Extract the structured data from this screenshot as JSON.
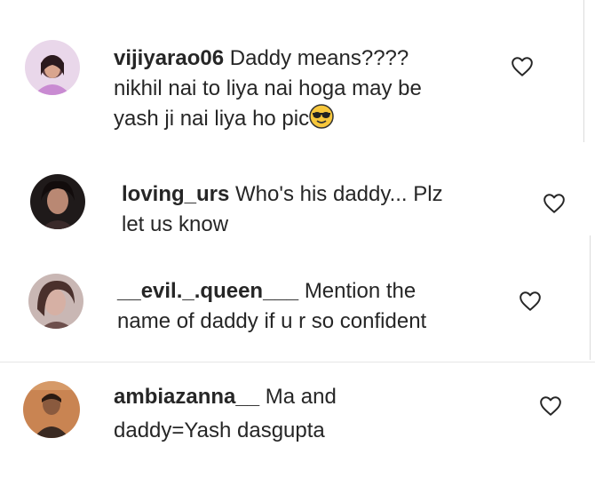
{
  "comments": [
    {
      "username": "vijiyarao06",
      "lines": [
        "Daddy means????",
        "nikhil nai to liya nai hoga may be",
        "yash ji nai liya ho pic"
      ],
      "emoji": "sunglasses-emoji",
      "avatar_color": "#c98bd2"
    },
    {
      "username": "loving_urs",
      "lines": [
        "Who's his daddy... Plz",
        "let us know"
      ],
      "avatar_color": "#5a3a33"
    },
    {
      "username": "__evil._.queen___",
      "lines": [
        "Mention the",
        "name of daddy if u r so confident"
      ],
      "avatar_color": "#7a5a55"
    },
    {
      "username": "ambiazanna__",
      "lines": [
        "Ma and",
        "daddy=Yash dasgupta"
      ],
      "avatar_color": "#b06d3d"
    }
  ],
  "icons": {
    "like": "heart-outline-icon"
  },
  "colors": {
    "text": "#262626",
    "background": "#ffffff",
    "divider": "#dbdbdb"
  }
}
